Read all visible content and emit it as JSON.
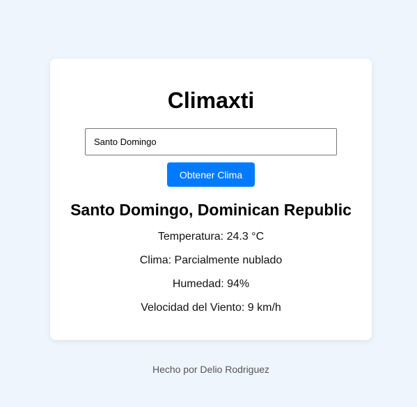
{
  "app": {
    "title": "Climaxti"
  },
  "search": {
    "value": "Santo Domingo",
    "button_label": "Obtener Clima"
  },
  "weather": {
    "location": "Santo Domingo, Dominican Republic",
    "temperature_label": "Temperatura:",
    "temperature_value": "24.3 °C",
    "condition_label": "Clima:",
    "condition_value": "Parcialmente nublado",
    "humidity_label": "Humedad:",
    "humidity_value": "94%",
    "wind_label": "Velocidad del Viento:",
    "wind_value": "9 km/h"
  },
  "footer": {
    "text": "Hecho por Delio Rodriguez"
  },
  "colors": {
    "background": "#eef5fd",
    "card": "#ffffff",
    "accent": "#007bff"
  }
}
